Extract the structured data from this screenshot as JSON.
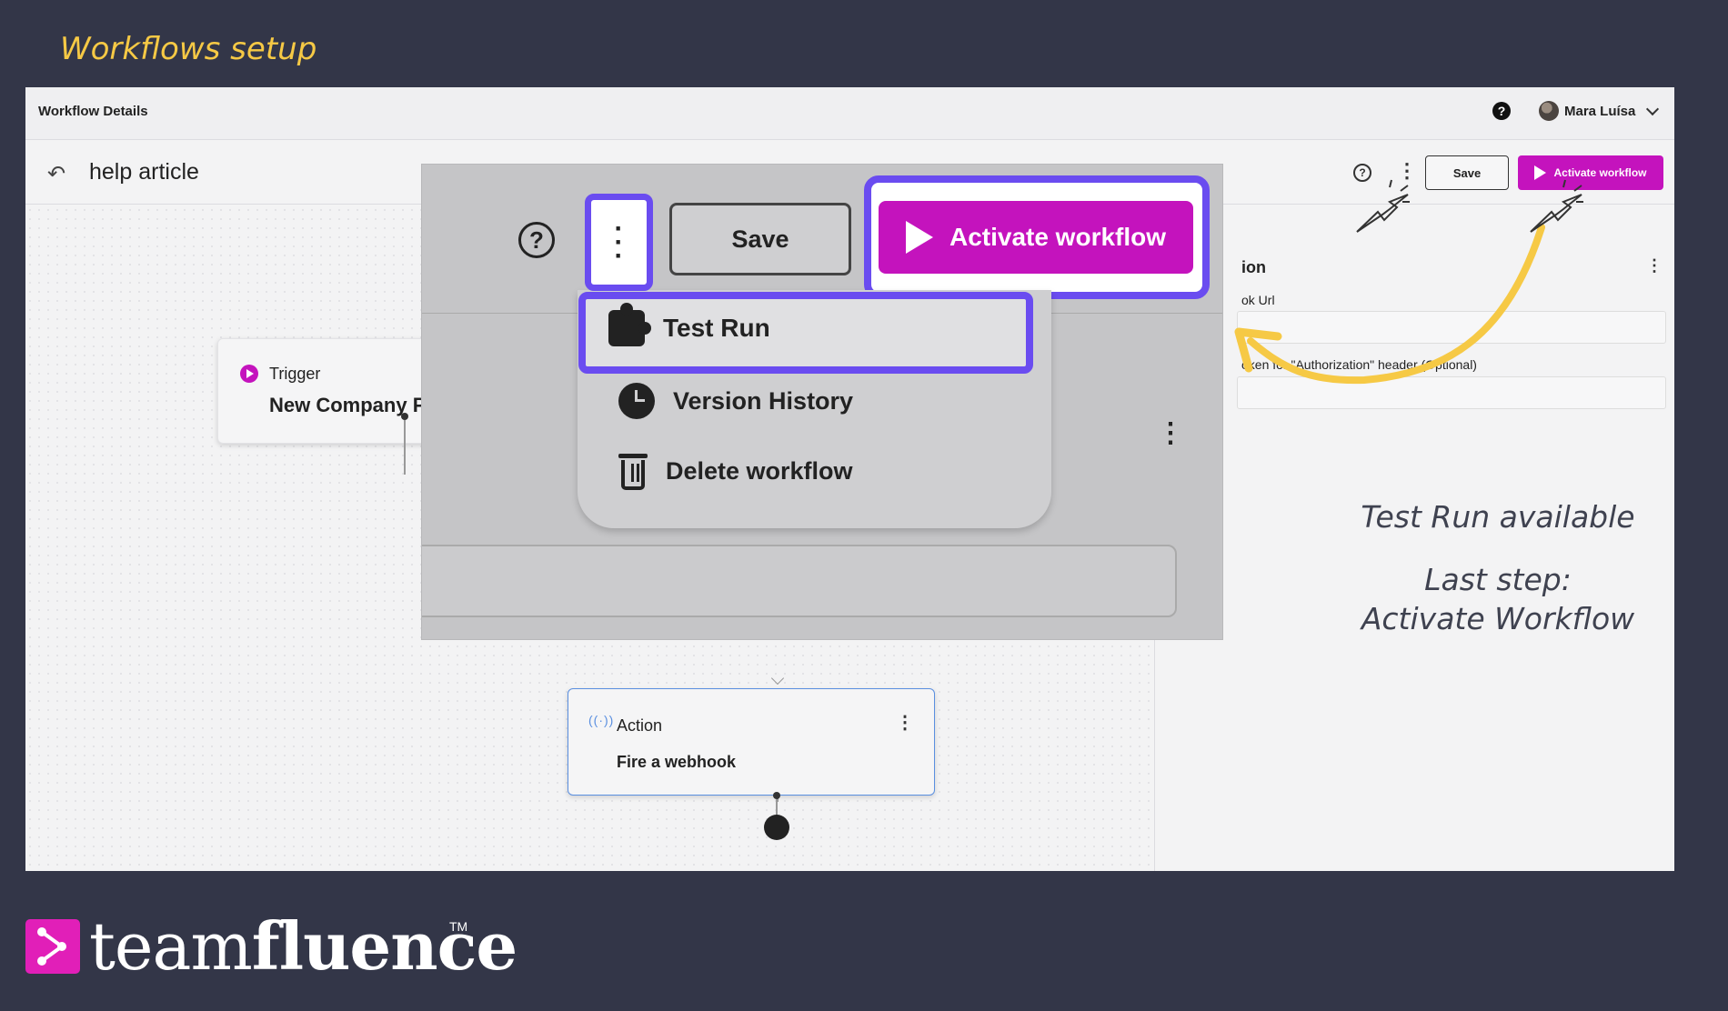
{
  "slide": {
    "title": "Workflows setup",
    "note_test_run": "Test Run available",
    "note_last_step_line1": "Last step:",
    "note_last_step_line2": "Activate Workflow"
  },
  "topbar": {
    "breadcrumb": "Workflow Details",
    "help": "?",
    "user_name": "Mara Luísa"
  },
  "header": {
    "back_icon": "back-arrow-icon",
    "workflow_name": "help article",
    "help": "?",
    "kebab": "⋮",
    "save_label": "Save",
    "activate_label": "Activate workflow"
  },
  "canvas": {
    "trigger": {
      "label": "Trigger",
      "name": "New Company Pa"
    },
    "action": {
      "label": "Action",
      "name": "Fire a webhook",
      "icon": "((·))"
    }
  },
  "right_panel": {
    "title": "ion",
    "label_url": "ok Url",
    "label_token": "oken for \"Authorization\" header (Optional)"
  },
  "zoom": {
    "help": "?",
    "kebab": "⋮",
    "save_label": "Save",
    "activate_label": "Activate workflow",
    "menu": [
      {
        "label": "Test Run",
        "icon": "puzzle-icon"
      },
      {
        "label": "Version History",
        "icon": "clock-icon"
      },
      {
        "label": "Delete workflow",
        "icon": "trash-icon"
      }
    ],
    "right_kebab": "⋮"
  },
  "footer": {
    "brand_light": "team",
    "brand_bold": "fluence",
    "tm": "TM"
  },
  "colors": {
    "accent": "#c413bd",
    "highlight": "#6a4cf0",
    "title_yellow": "#f6c945",
    "background": "#333648"
  }
}
